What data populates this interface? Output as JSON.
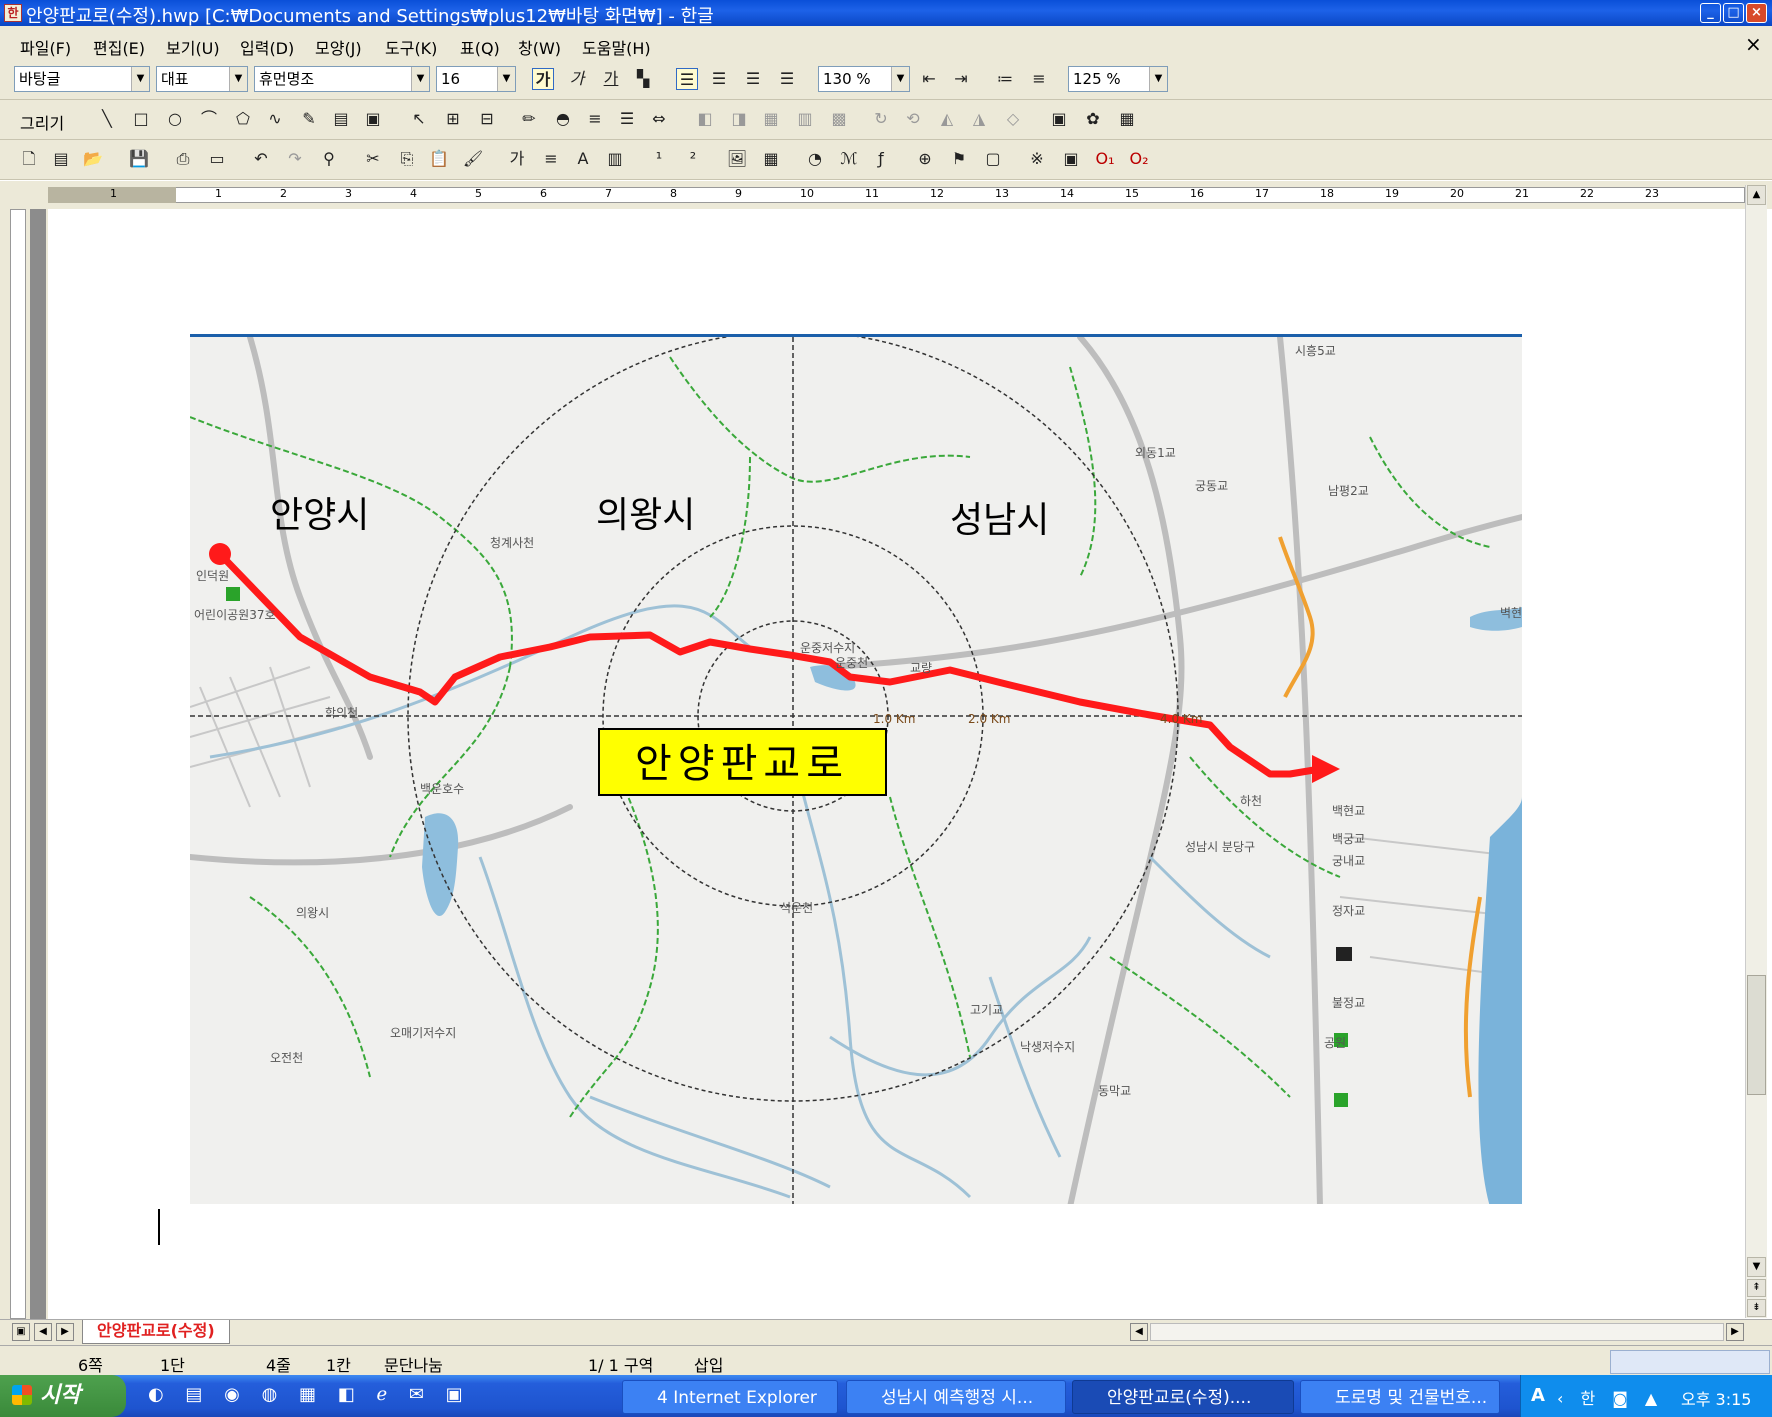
{
  "window": {
    "title": "안양판교로(수정).hwp [C:₩Documents and Settings₩plus12₩바탕 화면₩] - 한글"
  },
  "menu": [
    "파일(F)",
    "편집(E)",
    "보기(U)",
    "입력(D)",
    "모양(J)",
    "도구(K)",
    "표(Q)",
    "창(W)",
    "도움말(H)"
  ],
  "format": {
    "style": "바탕글",
    "font_lang": "대표",
    "font": "휴먼명조",
    "size": "16",
    "spacing": "130 %",
    "zoom": "125 %"
  },
  "toolbar": {
    "draw_label": "그리기"
  },
  "ruler": {
    "ticks": [
      "1",
      "1",
      "2",
      "3",
      "4",
      "5",
      "6",
      "7",
      "8",
      "9",
      "10",
      "11",
      "12",
      "13",
      "14",
      "15",
      "16",
      "17",
      "18",
      "19",
      "20",
      "21",
      "22",
      "23"
    ]
  },
  "map": {
    "city_labels": [
      "안양시",
      "의왕시",
      "성남시"
    ],
    "route_label": "안양판교로",
    "distance_labels": [
      "1.0 Km",
      "2.0 Km",
      "4.0 Km"
    ],
    "place_labels": [
      "청계사천",
      "운중저수지",
      "운중천",
      "교량",
      "학의천",
      "백운호수",
      "의왕시",
      "오매기저수지",
      "오전천",
      "석운천",
      "하천",
      "고기교",
      "낙생저수지",
      "동막교",
      "외동1교",
      "궁동교",
      "남평2교",
      "시흥5교",
      "성남시 분당구",
      "백현교",
      "백궁교",
      "궁내교",
      "정자교",
      "불정교",
      "공원",
      "어린이공원37호",
      "인덕원",
      "벽현"
    ],
    "colors": {
      "route": "#ff1a1a",
      "label_bg": "#ffff00"
    }
  },
  "tabs": {
    "doc": "안양판교로(수정)"
  },
  "status": {
    "page": "6쪽",
    "section": "1단",
    "line": "4줄",
    "col": "1칸",
    "mode": "문단나눔",
    "pagecount": "1/ 1 구역",
    "insert": "삽입"
  },
  "taskbar": {
    "start": "시작",
    "items": [
      "4 Internet Explorer",
      "성남시 예측행정 시...",
      "안양판교로(수정)....",
      "도로명 및 건물번호..."
    ],
    "clock": "오후 3:15"
  }
}
